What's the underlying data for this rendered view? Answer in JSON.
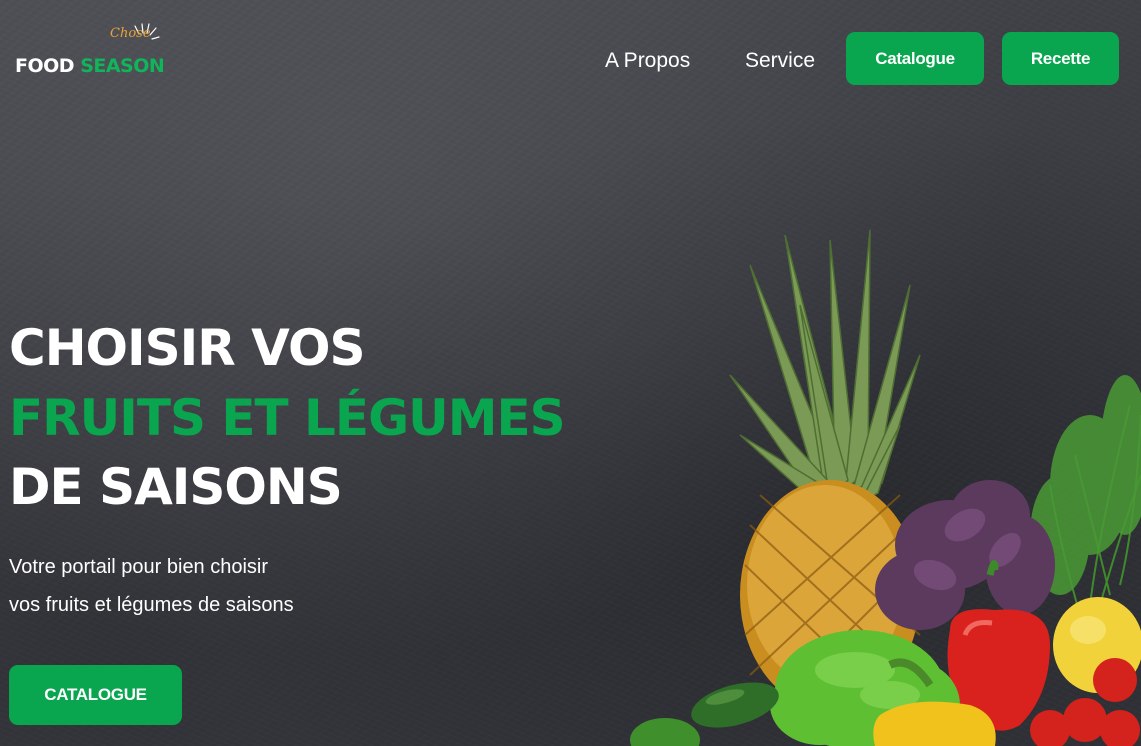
{
  "header": {
    "logo": {
      "script": "Chose",
      "word1": "FOOD",
      "word2": "SEASON"
    },
    "nav": {
      "about": "A Propos",
      "service": "Service",
      "catalogue": "Catalogue",
      "recipe": "Recette"
    }
  },
  "hero": {
    "line1": "CHOISIR VOS",
    "line2": "FRUITS ET LÉGUMES",
    "line3": "DE SAISONS",
    "sub1": "Votre portail pour bien choisir",
    "sub2": "vos fruits et légumes de saisons",
    "cta": "CATALOGUE"
  },
  "colors": {
    "accent": "#0aa64f",
    "logo_script": "#e8a33a",
    "background": "#3d3f45"
  },
  "icons": {
    "logo_rays": "sun-rays-icon"
  }
}
